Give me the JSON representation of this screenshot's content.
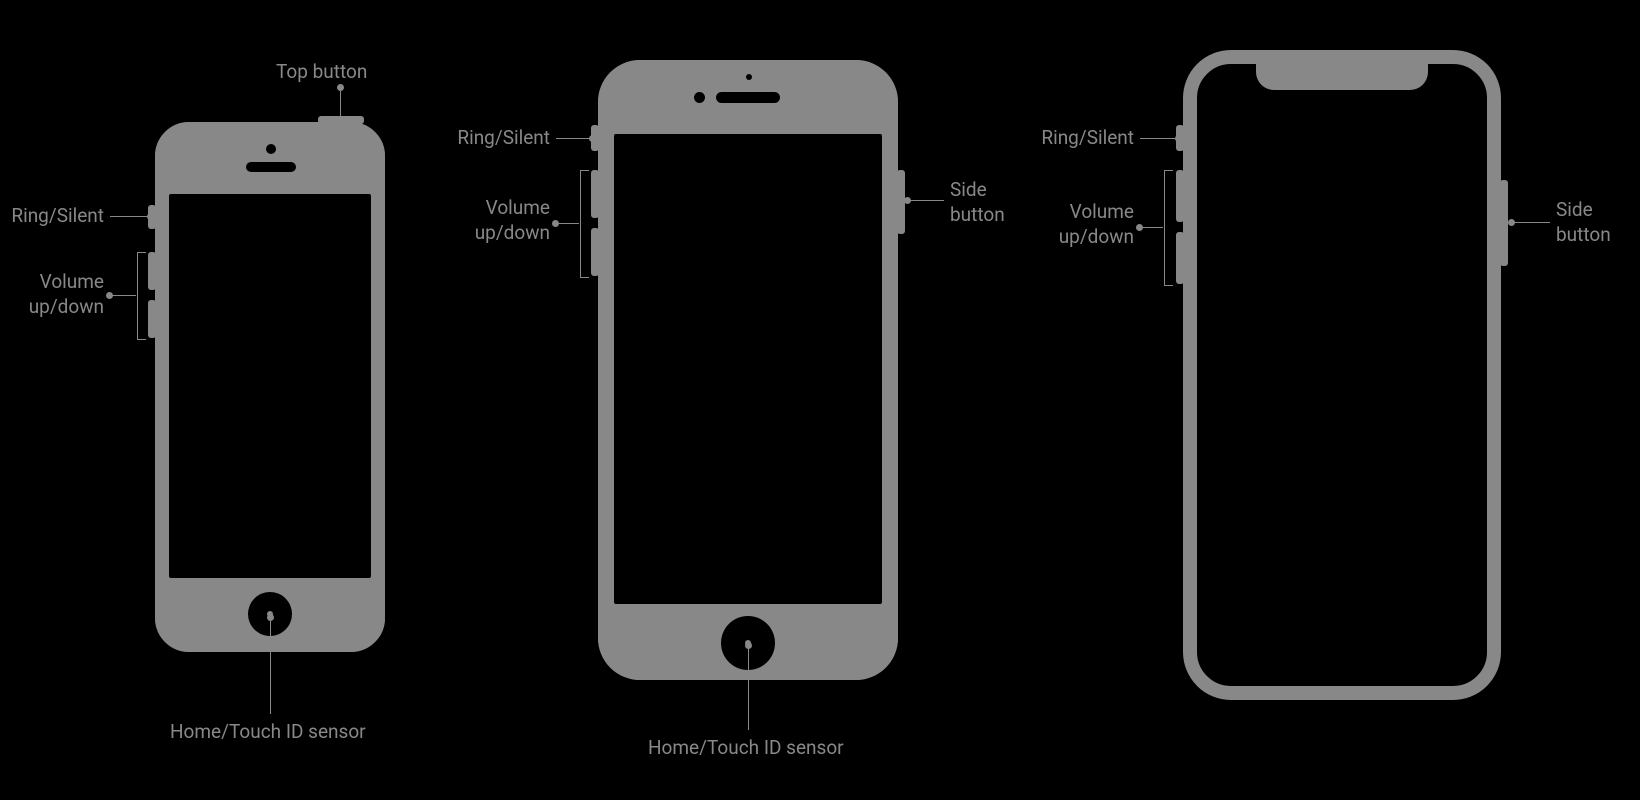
{
  "labels": {
    "top_button": "Top button",
    "ring_silent": "Ring/Silent",
    "volume": "Volume\nup/down",
    "side_button": "Side\nbutton",
    "home": "Home/Touch ID sensor"
  },
  "phones": [
    {
      "id": "iphone-se",
      "has_home": true,
      "has_top_button": true,
      "has_side_button": false,
      "has_notch": false
    },
    {
      "id": "iphone-8",
      "has_home": true,
      "has_top_button": false,
      "has_side_button": true,
      "has_notch": false
    },
    {
      "id": "iphone-x",
      "has_home": false,
      "has_top_button": false,
      "has_side_button": true,
      "has_notch": true
    }
  ]
}
